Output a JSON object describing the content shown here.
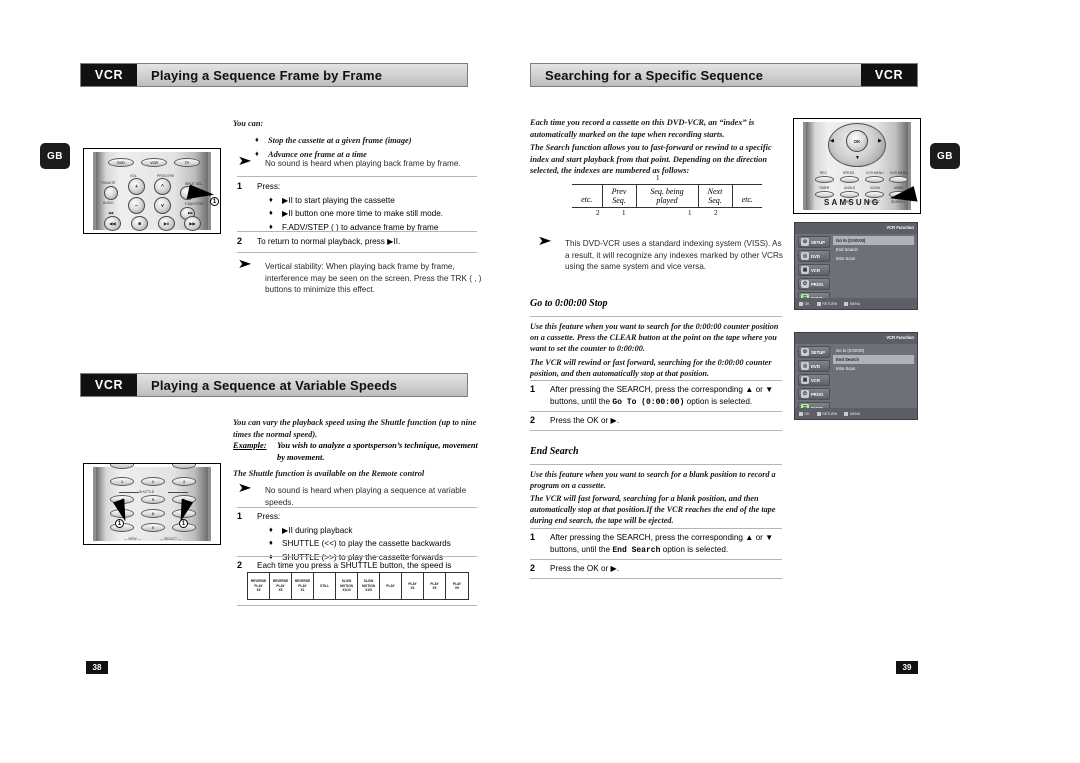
{
  "document": {
    "brand": "SAMSUNG",
    "gb_badge": "GB"
  },
  "left_page": {
    "number": "38",
    "section1": {
      "tag": "VCR",
      "title": "Playing a Sequence Frame by Frame",
      "lead": "You can:",
      "bullets": [
        "Stop the cassette at a given frame (image)",
        "Advance one frame at a time"
      ],
      "note": "No sound is heard when playing back frame by frame.",
      "steps": [
        {
          "num": "1",
          "text": "Press:",
          "bullets": [
            "▶II to start playing the cassette",
            "▶II button one more time to make still mode.",
            "F.ADV/STEP (      ) to advance frame by frame"
          ]
        },
        {
          "num": "2",
          "text": "To return to normal playback, press ▶II."
        }
      ],
      "note2": "Vertical stability: When playing back frame by frame, interference may be seen on the screen. Press the TRK (      ,      ) buttons to minimize this effect."
    },
    "section2": {
      "tag": "VCR",
      "title": "Playing a Sequence at Variable Speeds",
      "intro": "You can vary the playback speed using the Shuttle function (up to nine times the normal speed).",
      "example_label": "Example:",
      "example_text": "You wish to analyze a sportsperson’s technique, movement by movement.",
      "availability": "The Shuttle function is available on the Remote control",
      "note": "No sound is heard when playing a sequence at variable speeds.",
      "steps": [
        {
          "num": "1",
          "text": "Press:",
          "bullets": [
            "▶II during playback",
            "SHUTTLE (<<) to play the cassette backwards",
            "SHUTTLE (>>) to play the cassette forwards"
          ]
        },
        {
          "num": "2",
          "text": "Each time you press a SHUTTLE button, the speed is changed as shown in the following illustration."
        }
      ],
      "speed_table": [
        {
          "l1": "REVERSE",
          "l2": "PLAY",
          "l3": "X9"
        },
        {
          "l1": "REVERSE",
          "l2": "PLAY",
          "l3": "X5"
        },
        {
          "l1": "REVERSE",
          "l2": "PLAY",
          "l3": "X1"
        },
        {
          "l1": "",
          "l2": "STILL",
          "l3": ""
        },
        {
          "l1": "SLOW",
          "l2": "MOTION",
          "l3": "X1/10"
        },
        {
          "l1": "SLOW",
          "l2": "MOTION",
          "l3": "X1/5"
        },
        {
          "l1": "",
          "l2": "PLAY",
          "l3": ""
        },
        {
          "l1": "",
          "l2": "PLAY",
          "l3": "X3"
        },
        {
          "l1": "",
          "l2": "PLAY",
          "l3": "X5"
        },
        {
          "l1": "",
          "l2": "PLAY",
          "l3": "X9"
        }
      ]
    },
    "remote_top": {
      "mode_buttons": [
        "DVD",
        "VCR",
        "TV"
      ],
      "labels": [
        "VOL.",
        "PROG/TRK",
        "TV/LATE",
        "AUDIO",
        "INPUT SEL.",
        "F.ADV/STEP"
      ],
      "callout": "1"
    },
    "remote_bottom": {
      "keys": [
        "1",
        "2",
        "3",
        "4",
        "5",
        "6",
        "7",
        "8",
        "9",
        "0"
      ],
      "shuttle_label": "SHUTTLE",
      "footer_left": "VIEW",
      "footer_right": "SELECT",
      "callout_left": "1",
      "callout_right": "1"
    }
  },
  "right_page": {
    "number": "39",
    "section": {
      "tag": "VCR",
      "title": "Searching for a Specific Sequence",
      "intro1": "Each time you record a cassette on this DVD-VCR, an “index” is automatically marked on the tape when recording starts.",
      "intro2": "The Search function allows you to fast-forward or rewind to a specific index and start playback from that point. Depending on the direction selected, the indexes are numbered as follows:",
      "index_table": {
        "top_marker": "1",
        "cells": [
          "etc.",
          "Prev Seq.",
          "Seq. being played",
          "Next Seq.",
          "etc."
        ],
        "bottom_markers": [
          "2",
          "1",
          "1",
          "2"
        ]
      },
      "note": "This DVD-VCR uses a standard indexing system (VISS). As a result, it will recognize any indexes marked by other VCRs using the same system and vice versa."
    },
    "goto": {
      "heading": "Go to 0:00:00 Stop",
      "body1": "Use this feature when you want to search for the 0:00:00 counter position on a cassette. Press the CLEAR button at the point on the tape where you want to set the counter to 0:00:00.",
      "body2": "The VCR will rewind or fast forward, searching for the 0:00:00 counter position, and then automatically stop at that position.",
      "steps": [
        {
          "num": "1",
          "text_a": "After pressing the SEARCH, press the corresponding ▲ or ▼ buttons, until the ",
          "code": "Go To (0:00:00)",
          "text_b": " option is selected."
        },
        {
          "num": "2",
          "text_a": "Press the OK or ▶."
        }
      ]
    },
    "end_search": {
      "heading": "End Search",
      "body1": "Use this feature when you want to search for a blank position to record a program on a cassette.",
      "body2": "The VCR will fast forward, searching for a blank position, and then automatically stop at that position.If the VCR reaches the end of the tape during end search, the tape will be ejected.",
      "steps": [
        {
          "num": "1",
          "text_a": "After pressing the SEARCH, press the corresponding ▲ or ▼ buttons, until the ",
          "code": "End Search",
          "text_b": " option is selected."
        },
        {
          "num": "2",
          "text_a": "Press the OK or ▶."
        }
      ]
    },
    "remote": {
      "ok_label": "OK",
      "labels_row1": [
        "REC",
        "SPEED",
        "VCR MENU",
        "DVD MENU"
      ],
      "labels_row2": [
        "TIMER",
        "ANGLE",
        "ZOOM",
        "MARK"
      ],
      "labels_row3": [
        "TRK",
        "REPEAT",
        "SEARCH"
      ],
      "wordmark": "SAMSUNG"
    },
    "osd_goto": {
      "title": "VCR Function",
      "sidebar": [
        "SETUP",
        "DVD",
        "VCR",
        "PROG",
        "FUNC"
      ],
      "options": [
        "Go to (0:00:00)",
        "End Search",
        "Intro Scan"
      ],
      "selected": "Go to (0:00:00)",
      "footer": [
        "OK",
        "RETURN",
        "MENU"
      ]
    },
    "osd_end_search": {
      "title": "VCR Function",
      "sidebar": [
        "SETUP",
        "DVD",
        "VCR",
        "PROG",
        "FUNC"
      ],
      "options": [
        "Go to (0:00:00)",
        "End Search",
        "Intro Scan"
      ],
      "selected": "End Search",
      "footer": [
        "OK",
        "RETURN",
        "MENU"
      ]
    }
  }
}
